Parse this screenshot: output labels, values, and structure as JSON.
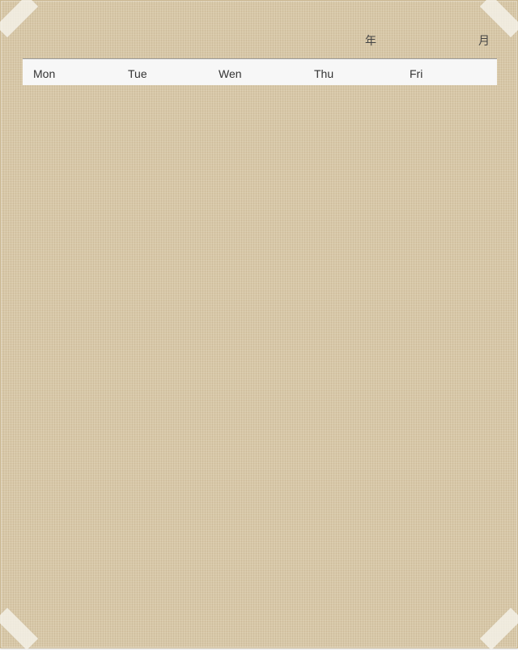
{
  "planner": {
    "year_label": "年",
    "month_label": "月",
    "weekdays": [
      "Mon",
      "Tue",
      "Wen",
      "Thu",
      "Fri"
    ]
  },
  "colors": {
    "frame": "#d8c8a8",
    "sheet": "#ffffff",
    "header_bar": "#f7f7f7",
    "rule": "#9a9a9a",
    "text": "#333333"
  }
}
